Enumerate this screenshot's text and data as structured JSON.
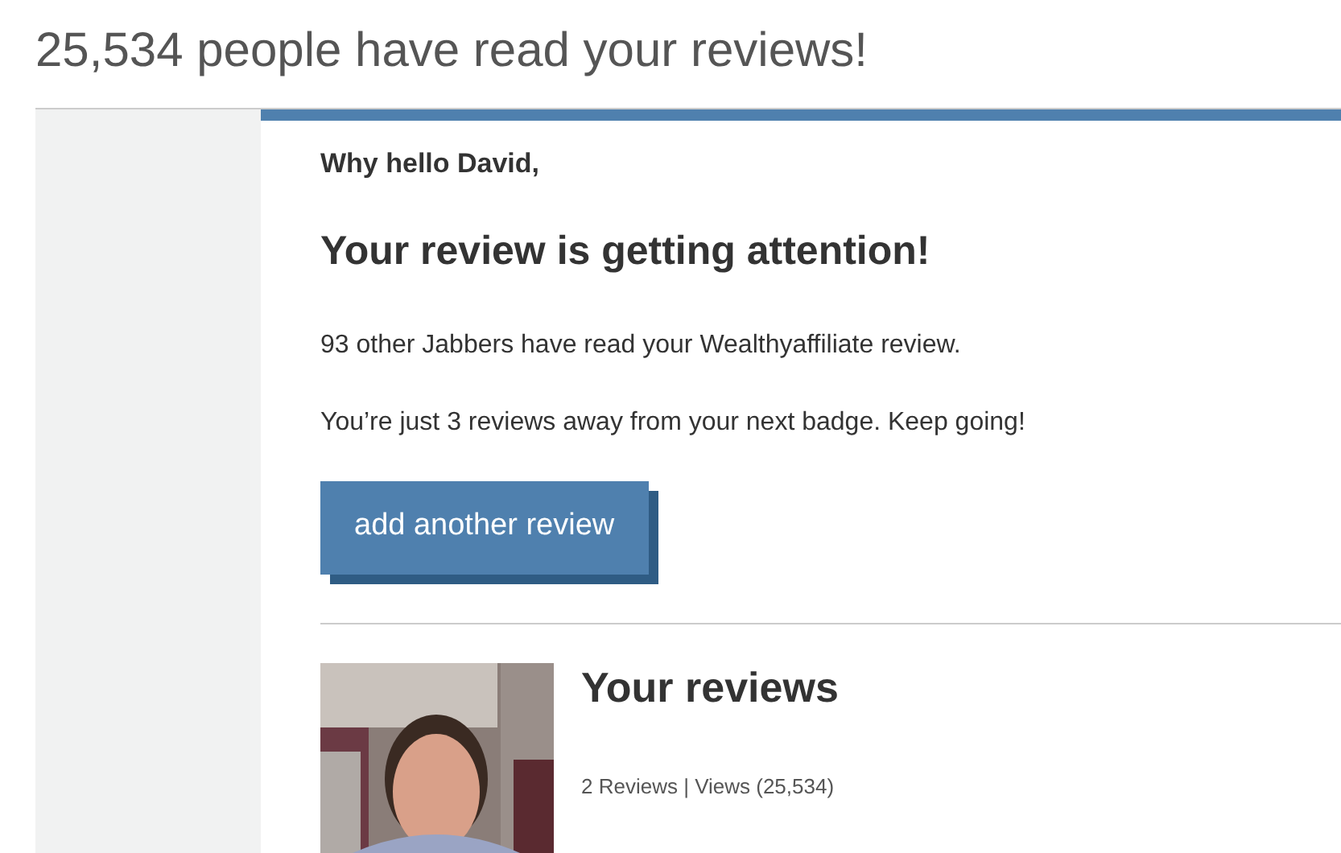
{
  "page_title": "25,534 people have read your reviews!",
  "email": {
    "greeting": "Why hello David,",
    "headline": "Your review is getting attention!",
    "paragraphs": [
      "93 other Jabbers have read your Wealthyaffiliate review.",
      "You’re just 3 reviews away from your next badge. Keep going!"
    ],
    "button": "add another review"
  },
  "profile": {
    "heading": "Your reviews",
    "stats": "2 Reviews | Views (25,534)"
  }
}
